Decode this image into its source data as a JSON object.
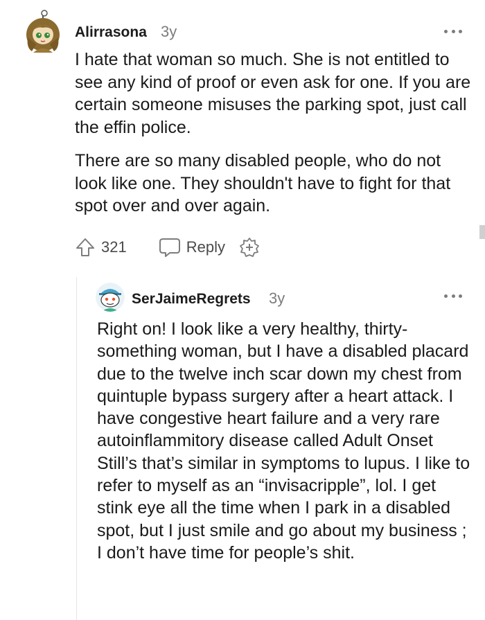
{
  "comments": [
    {
      "username": "Alirrasona",
      "age": "3y",
      "paragraphs": [
        "I hate that woman so much. She is not entitled to see any kind of proof or even ask for one. If you are certain someone misuses the parking spot, just call the effin police.",
        "There are so many disabled people, who do not look like one. They shouldn't have to fight for that spot over and over again."
      ],
      "votes": "321",
      "reply_label": "Reply"
    },
    {
      "username": "SerJaimeRegrets",
      "age": "3y",
      "paragraphs": [
        "Right on! I look like a very healthy, thirty-something woman, but I have a disabled placard due to the twelve inch scar down my chest from quintuple bypass surgery after a heart attack. I have congestive heart failure and a very rare autoinflammitory disease called Adult Onset Still’s that’s similar in symptoms to lupus. I like to refer to myself as an “invisacripple”, lol. I get stink eye all the time when I park in a disabled spot, but I just smile and go about my business ; I don’t have time for people’s shit."
      ]
    }
  ],
  "icons": {
    "more": "more-options-icon",
    "upvote": "upvote-arrow-icon",
    "reply": "speech-bubble-icon",
    "award": "add-award-icon"
  },
  "colors": {
    "text": "#1a1a1b",
    "muted": "#7c7c7c",
    "thread_line": "#e4e4e4"
  }
}
